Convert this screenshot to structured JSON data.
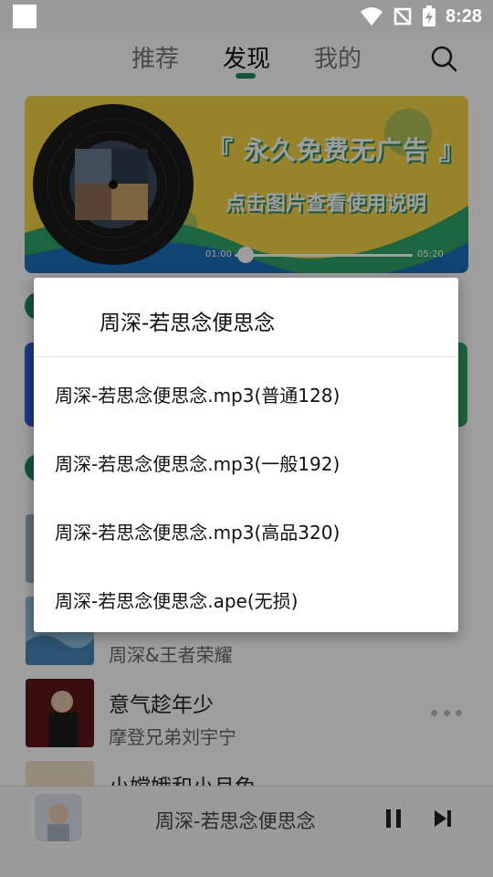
{
  "status_bar": {
    "time": "8:28"
  },
  "nav": {
    "tabs": [
      {
        "label": "推荐"
      },
      {
        "label": "发现"
      },
      {
        "label": "我的"
      }
    ],
    "active_tab": "发现"
  },
  "banner": {
    "headline": "『 永久免费无广告 』",
    "subtitle": "点击图片查看使用说明",
    "time_elapsed": "01:00",
    "time_total": "05:20"
  },
  "songs": [
    {
      "title": "",
      "artist": "周深&王者荣耀"
    },
    {
      "title": "意气趁年少",
      "artist": "摩登兄弟刘宇宁"
    },
    {
      "title": "小嫦娥和小月兔",
      "artist": ""
    }
  ],
  "player": {
    "now_playing": "周深-若思念便思念"
  },
  "dialog": {
    "title": "周深-若思念便思念",
    "options": [
      {
        "label": "周深-若思念便思念.mp3(普通128)"
      },
      {
        "label": "周深-若思念便思念.mp3(一般192)"
      },
      {
        "label": "周深-若思念便思念.mp3(高品320)"
      },
      {
        "label": "周深-若思念便思念.ape(无损)"
      }
    ]
  },
  "colors": {
    "accent": "#1f8a5b",
    "banner_bg": "#f5d34a",
    "scrim": "rgba(0,0,0,0.38)"
  },
  "icons": {
    "search": "search-icon",
    "more": "more-horizontal-icon",
    "pause": "pause-icon",
    "next": "skip-next-icon",
    "wifi": "wifi-icon",
    "signal": "no-signal-icon",
    "battery": "battery-charging-icon"
  }
}
